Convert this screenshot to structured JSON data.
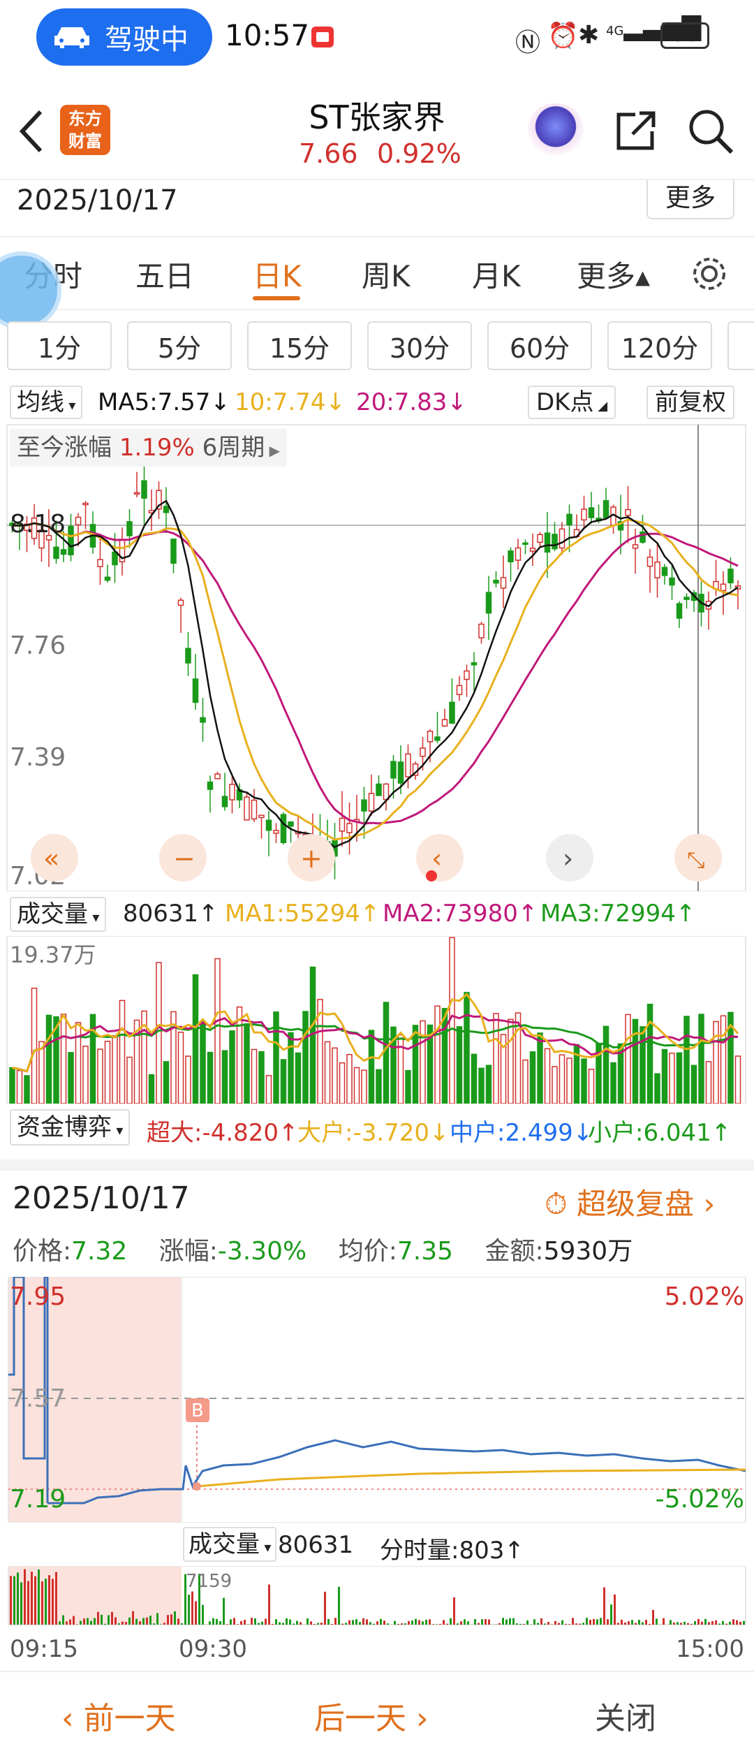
{
  "status_bar": {
    "driving_label": "驾驶中",
    "time": "10:57",
    "signal_label": "4G",
    "battery": "56"
  },
  "header": {
    "logo_text_1": "东方",
    "logo_text_2": "财富",
    "stock_name": "ST张家界",
    "price": "7.66",
    "change_pct": "0.92%"
  },
  "navbar": {
    "date": "2025/10/17",
    "more": "更多"
  },
  "tabs": [
    "分时",
    "五日",
    "日K",
    "周K",
    "月K",
    "更多▴"
  ],
  "subtabs": [
    "1分",
    "5分",
    "15分",
    "30分",
    "60分",
    "120分"
  ],
  "ma_bar": {
    "selector": "均线",
    "ma5": "MA5:7.57↓",
    "ma10": "10:7.74↓",
    "ma20": "20:7.83↓",
    "dk": "DK点",
    "fq": "前复权"
  },
  "kchart": {
    "gain_label": "至今涨幅",
    "gain_value": "1.19%",
    "period": "6周期",
    "y_labels": [
      "8.18",
      "7.76",
      "7.39",
      "7.02"
    ]
  },
  "volume_bar": {
    "selector": "成交量",
    "value": "80631↑",
    "ma1": "MA1:55294↑",
    "ma2": "MA2:73980↑",
    "ma3": "MA3:72994↑",
    "max_label": "19.37万"
  },
  "capital_bar": {
    "selector": "资金博弈",
    "super": "超大:-4.820↑",
    "large": "大户:-3.720↓",
    "mid": "中户:2.499↓",
    "small": "小户:6.041↑"
  },
  "detail": {
    "date": "2025/10/17",
    "replay": "超级复盘",
    "price_label": "价格:",
    "price": "7.32",
    "chg_label": "涨幅:",
    "chg": "-3.30%",
    "avg_label": "均价:",
    "avg": "7.35",
    "amount_label": "金额:",
    "amount": "5930万"
  },
  "intraday": {
    "high": "7.95",
    "mid": "7.57",
    "low": "7.19",
    "pct_high": "5.02%",
    "pct_low": "-5.02%",
    "b_marker": "B"
  },
  "intra_vol": {
    "selector": "成交量",
    "value": "80631",
    "fs_label": "分时量:803↑",
    "peak": "7159",
    "t_start": "09:15",
    "t_mid": "09:30",
    "t_end": "15:00"
  },
  "footer": {
    "prev": "前一天",
    "next": "后一天",
    "close": "关闭"
  },
  "colors": {
    "up": "#d0302c",
    "down": "#1a9a1a",
    "accent": "#e0701c",
    "ma5": "#111111",
    "ma10": "#e8b01c",
    "ma20": "#c0187a",
    "blue_pill": "#1e6ef0"
  }
}
